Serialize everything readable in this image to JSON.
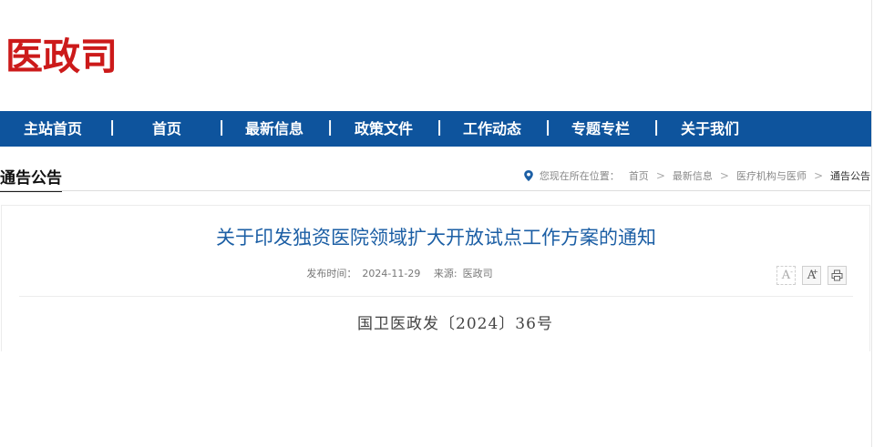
{
  "site": {
    "logo_text": "医政司"
  },
  "nav": {
    "items": [
      {
        "label": "主站首页"
      },
      {
        "label": "首页"
      },
      {
        "label": "最新信息"
      },
      {
        "label": "政策文件"
      },
      {
        "label": "工作动态"
      },
      {
        "label": "专题专栏"
      },
      {
        "label": "关于我们"
      }
    ],
    "separator": "|"
  },
  "section": {
    "title": "通告公告"
  },
  "breadcrumb": {
    "icon": "location-pin-icon",
    "prefix": "您现在所在位置：",
    "items": [
      "首页",
      "最新信息",
      "医疗机构与医师",
      "通告公告"
    ],
    "separator": ">"
  },
  "article": {
    "title": "关于印发独资医院领域扩大开放试点工作方案的通知",
    "publish_label": "发布时间：",
    "publish_date": "2024-11-29",
    "source_label": "来源:",
    "source": "医政司",
    "doc_number": "国卫医政发〔2024〕36号"
  },
  "tools": {
    "font_decrease_label": "A",
    "font_decrease_mark": "-",
    "font_increase_label": "A",
    "font_increase_mark": "+",
    "print_icon": "print-icon"
  },
  "colors": {
    "brand_red": "#cc1a1a",
    "nav_blue": "#0e549d",
    "title_blue": "#1c5fa5"
  }
}
